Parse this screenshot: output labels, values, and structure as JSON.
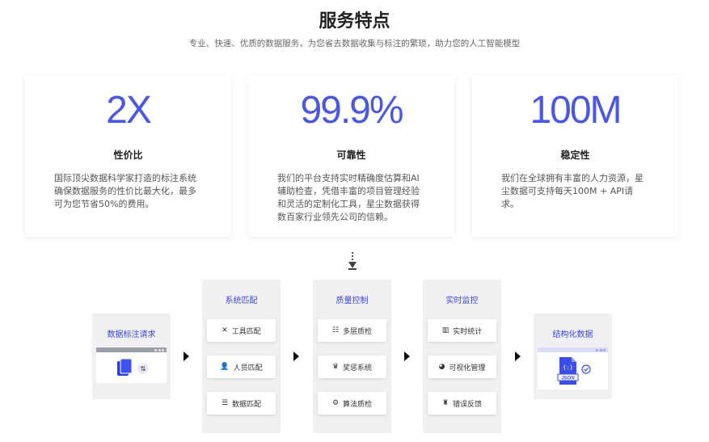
{
  "header": {
    "title": "服务特点",
    "subtitle": "专业、快速、优质的数据服务，为您省去数据收集与标注的繁琐，助力您的人工智能模型"
  },
  "cards": [
    {
      "big": "2X",
      "title": "性价比",
      "desc": "国际顶尖数据科学家打造的标注系统确保数据服务的性价比最大化，最多可为您节省50%的费用。"
    },
    {
      "big": "99.9%",
      "title": "可靠性",
      "desc": "我们的平台支持实时精确度估算和AI辅助检查，凭借丰富的项目管理经验和灵活的定制化工具，星尘数据获得数百家行业领先公司的信赖。"
    },
    {
      "big": "100M",
      "title": "稳定性",
      "desc": "我们在全球拥有丰富的人力资源，星尘数据可支持每天100M + API请求。"
    }
  ],
  "flow": {
    "request": {
      "label": "数据标注请求"
    },
    "match": {
      "label": "系统匹配",
      "items": [
        {
          "icon": "tools-icon",
          "glyph": "✕",
          "label": "工具匹配"
        },
        {
          "icon": "user-plus-icon",
          "glyph": "👤",
          "label": "人员匹配"
        },
        {
          "icon": "database-icon",
          "glyph": "☰",
          "label": "数据匹配"
        }
      ]
    },
    "quality": {
      "label": "质量控制",
      "items": [
        {
          "icon": "list-icon",
          "glyph": "☷",
          "label": "多层质检"
        },
        {
          "icon": "award-icon",
          "glyph": "♛",
          "label": "奖惩系统"
        },
        {
          "icon": "gear-icon",
          "glyph": "⚙",
          "label": "算法质检"
        }
      ]
    },
    "monitor": {
      "label": "实时监控",
      "items": [
        {
          "icon": "bar-chart-icon",
          "glyph": "▥",
          "label": "实时统计"
        },
        {
          "icon": "pie-chart-icon",
          "glyph": "◕",
          "label": "可视化管理"
        },
        {
          "icon": "bug-icon",
          "glyph": "♜",
          "label": "错误反馈"
        }
      ]
    },
    "output": {
      "label": "结构化数据",
      "file_label": "JSON"
    }
  },
  "colors": {
    "accent": "#4a57e0",
    "panel": "#f0f0f2",
    "label_blue": "#3b47d6"
  }
}
